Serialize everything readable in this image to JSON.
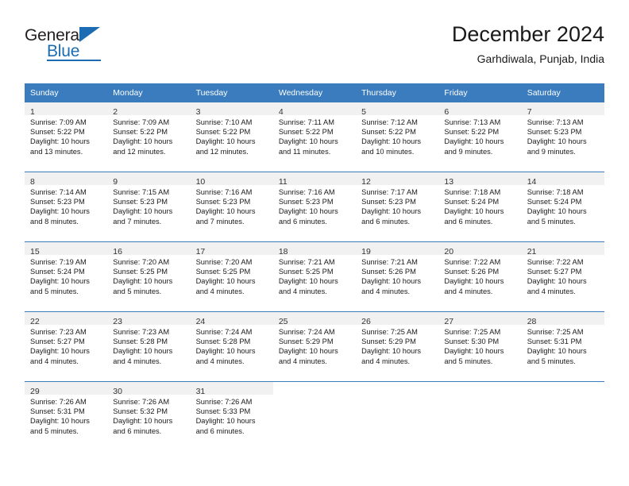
{
  "brand": {
    "name_top": "General",
    "name_bottom": "Blue",
    "accent_color": "#1b6cb2",
    "triangle_icon": "triangle-icon"
  },
  "header": {
    "title": "December 2024",
    "subtitle": "Garhdiwala, Punjab, India"
  },
  "calendar": {
    "header_bg": "#3a7cbd",
    "daynum_bg": "#f1f1f1",
    "weekdays": [
      "Sunday",
      "Monday",
      "Tuesday",
      "Wednesday",
      "Thursday",
      "Friday",
      "Saturday"
    ],
    "weeks": [
      [
        {
          "day": "1",
          "sunrise": "Sunrise: 7:09 AM",
          "sunset": "Sunset: 5:22 PM",
          "daylight1": "Daylight: 10 hours",
          "daylight2": "and 13 minutes."
        },
        {
          "day": "2",
          "sunrise": "Sunrise: 7:09 AM",
          "sunset": "Sunset: 5:22 PM",
          "daylight1": "Daylight: 10 hours",
          "daylight2": "and 12 minutes."
        },
        {
          "day": "3",
          "sunrise": "Sunrise: 7:10 AM",
          "sunset": "Sunset: 5:22 PM",
          "daylight1": "Daylight: 10 hours",
          "daylight2": "and 12 minutes."
        },
        {
          "day": "4",
          "sunrise": "Sunrise: 7:11 AM",
          "sunset": "Sunset: 5:22 PM",
          "daylight1": "Daylight: 10 hours",
          "daylight2": "and 11 minutes."
        },
        {
          "day": "5",
          "sunrise": "Sunrise: 7:12 AM",
          "sunset": "Sunset: 5:22 PM",
          "daylight1": "Daylight: 10 hours",
          "daylight2": "and 10 minutes."
        },
        {
          "day": "6",
          "sunrise": "Sunrise: 7:13 AM",
          "sunset": "Sunset: 5:22 PM",
          "daylight1": "Daylight: 10 hours",
          "daylight2": "and 9 minutes."
        },
        {
          "day": "7",
          "sunrise": "Sunrise: 7:13 AM",
          "sunset": "Sunset: 5:23 PM",
          "daylight1": "Daylight: 10 hours",
          "daylight2": "and 9 minutes."
        }
      ],
      [
        {
          "day": "8",
          "sunrise": "Sunrise: 7:14 AM",
          "sunset": "Sunset: 5:23 PM",
          "daylight1": "Daylight: 10 hours",
          "daylight2": "and 8 minutes."
        },
        {
          "day": "9",
          "sunrise": "Sunrise: 7:15 AM",
          "sunset": "Sunset: 5:23 PM",
          "daylight1": "Daylight: 10 hours",
          "daylight2": "and 7 minutes."
        },
        {
          "day": "10",
          "sunrise": "Sunrise: 7:16 AM",
          "sunset": "Sunset: 5:23 PM",
          "daylight1": "Daylight: 10 hours",
          "daylight2": "and 7 minutes."
        },
        {
          "day": "11",
          "sunrise": "Sunrise: 7:16 AM",
          "sunset": "Sunset: 5:23 PM",
          "daylight1": "Daylight: 10 hours",
          "daylight2": "and 6 minutes."
        },
        {
          "day": "12",
          "sunrise": "Sunrise: 7:17 AM",
          "sunset": "Sunset: 5:23 PM",
          "daylight1": "Daylight: 10 hours",
          "daylight2": "and 6 minutes."
        },
        {
          "day": "13",
          "sunrise": "Sunrise: 7:18 AM",
          "sunset": "Sunset: 5:24 PM",
          "daylight1": "Daylight: 10 hours",
          "daylight2": "and 6 minutes."
        },
        {
          "day": "14",
          "sunrise": "Sunrise: 7:18 AM",
          "sunset": "Sunset: 5:24 PM",
          "daylight1": "Daylight: 10 hours",
          "daylight2": "and 5 minutes."
        }
      ],
      [
        {
          "day": "15",
          "sunrise": "Sunrise: 7:19 AM",
          "sunset": "Sunset: 5:24 PM",
          "daylight1": "Daylight: 10 hours",
          "daylight2": "and 5 minutes."
        },
        {
          "day": "16",
          "sunrise": "Sunrise: 7:20 AM",
          "sunset": "Sunset: 5:25 PM",
          "daylight1": "Daylight: 10 hours",
          "daylight2": "and 5 minutes."
        },
        {
          "day": "17",
          "sunrise": "Sunrise: 7:20 AM",
          "sunset": "Sunset: 5:25 PM",
          "daylight1": "Daylight: 10 hours",
          "daylight2": "and 4 minutes."
        },
        {
          "day": "18",
          "sunrise": "Sunrise: 7:21 AM",
          "sunset": "Sunset: 5:25 PM",
          "daylight1": "Daylight: 10 hours",
          "daylight2": "and 4 minutes."
        },
        {
          "day": "19",
          "sunrise": "Sunrise: 7:21 AM",
          "sunset": "Sunset: 5:26 PM",
          "daylight1": "Daylight: 10 hours",
          "daylight2": "and 4 minutes."
        },
        {
          "day": "20",
          "sunrise": "Sunrise: 7:22 AM",
          "sunset": "Sunset: 5:26 PM",
          "daylight1": "Daylight: 10 hours",
          "daylight2": "and 4 minutes."
        },
        {
          "day": "21",
          "sunrise": "Sunrise: 7:22 AM",
          "sunset": "Sunset: 5:27 PM",
          "daylight1": "Daylight: 10 hours",
          "daylight2": "and 4 minutes."
        }
      ],
      [
        {
          "day": "22",
          "sunrise": "Sunrise: 7:23 AM",
          "sunset": "Sunset: 5:27 PM",
          "daylight1": "Daylight: 10 hours",
          "daylight2": "and 4 minutes."
        },
        {
          "day": "23",
          "sunrise": "Sunrise: 7:23 AM",
          "sunset": "Sunset: 5:28 PM",
          "daylight1": "Daylight: 10 hours",
          "daylight2": "and 4 minutes."
        },
        {
          "day": "24",
          "sunrise": "Sunrise: 7:24 AM",
          "sunset": "Sunset: 5:28 PM",
          "daylight1": "Daylight: 10 hours",
          "daylight2": "and 4 minutes."
        },
        {
          "day": "25",
          "sunrise": "Sunrise: 7:24 AM",
          "sunset": "Sunset: 5:29 PM",
          "daylight1": "Daylight: 10 hours",
          "daylight2": "and 4 minutes."
        },
        {
          "day": "26",
          "sunrise": "Sunrise: 7:25 AM",
          "sunset": "Sunset: 5:29 PM",
          "daylight1": "Daylight: 10 hours",
          "daylight2": "and 4 minutes."
        },
        {
          "day": "27",
          "sunrise": "Sunrise: 7:25 AM",
          "sunset": "Sunset: 5:30 PM",
          "daylight1": "Daylight: 10 hours",
          "daylight2": "and 5 minutes."
        },
        {
          "day": "28",
          "sunrise": "Sunrise: 7:25 AM",
          "sunset": "Sunset: 5:31 PM",
          "daylight1": "Daylight: 10 hours",
          "daylight2": "and 5 minutes."
        }
      ],
      [
        {
          "day": "29",
          "sunrise": "Sunrise: 7:26 AM",
          "sunset": "Sunset: 5:31 PM",
          "daylight1": "Daylight: 10 hours",
          "daylight2": "and 5 minutes."
        },
        {
          "day": "30",
          "sunrise": "Sunrise: 7:26 AM",
          "sunset": "Sunset: 5:32 PM",
          "daylight1": "Daylight: 10 hours",
          "daylight2": "and 6 minutes."
        },
        {
          "day": "31",
          "sunrise": "Sunrise: 7:26 AM",
          "sunset": "Sunset: 5:33 PM",
          "daylight1": "Daylight: 10 hours",
          "daylight2": "and 6 minutes."
        },
        {
          "day": "",
          "sunrise": "",
          "sunset": "",
          "daylight1": "",
          "daylight2": ""
        },
        {
          "day": "",
          "sunrise": "",
          "sunset": "",
          "daylight1": "",
          "daylight2": ""
        },
        {
          "day": "",
          "sunrise": "",
          "sunset": "",
          "daylight1": "",
          "daylight2": ""
        },
        {
          "day": "",
          "sunrise": "",
          "sunset": "",
          "daylight1": "",
          "daylight2": ""
        }
      ]
    ]
  }
}
